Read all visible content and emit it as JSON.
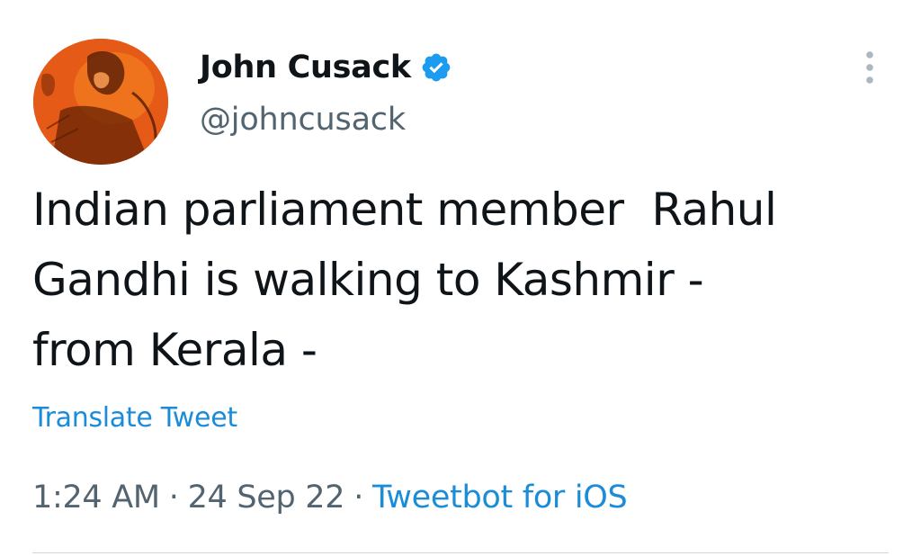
{
  "author": {
    "display_name": "John Cusack",
    "handle": "@johncusack",
    "avatar_icon": "avatar-photo",
    "verified_icon": "verified-badge-icon",
    "verified_color": "#1d9bf0"
  },
  "tweet": {
    "line1": "Indian parliament member  Rahul",
    "line2": "Gandhi is walking to Kashmir -",
    "line3": "from Kerala -"
  },
  "translate_label": "Translate Tweet",
  "meta": {
    "time": "1:24 AM",
    "separator": "·",
    "date": "24 Sep 22",
    "source": "Tweetbot for iOS"
  },
  "more_icon": "more-vertical-icon",
  "colors": {
    "text_primary": "#0f1419",
    "text_secondary": "#536471",
    "link": "#1a8cd8",
    "divider": "#cfd9de"
  }
}
